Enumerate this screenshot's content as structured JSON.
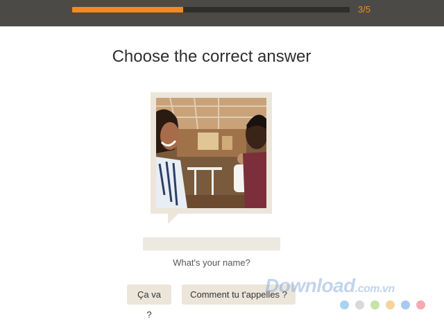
{
  "progress": {
    "value_fraction": 0.4,
    "label": "3/5"
  },
  "title": "Choose the correct answer",
  "photo": {
    "alt_icon": "photo-icon"
  },
  "question": "What's your name?",
  "choices": [
    {
      "label": "Ça va ?"
    },
    {
      "label": "Comment tu t'appelles ?"
    }
  ],
  "watermark": {
    "brand": "Download",
    "suffix": ".com.vn",
    "dot_colors": [
      "#a9d4f0",
      "#d9d9d9",
      "#c6e3a8",
      "#f6d39a",
      "#a9c9f0",
      "#f6a9b0"
    ]
  },
  "colors": {
    "header_bg": "#4b4a46",
    "accent": "#f4891f",
    "card_bg": "#ece6da"
  }
}
